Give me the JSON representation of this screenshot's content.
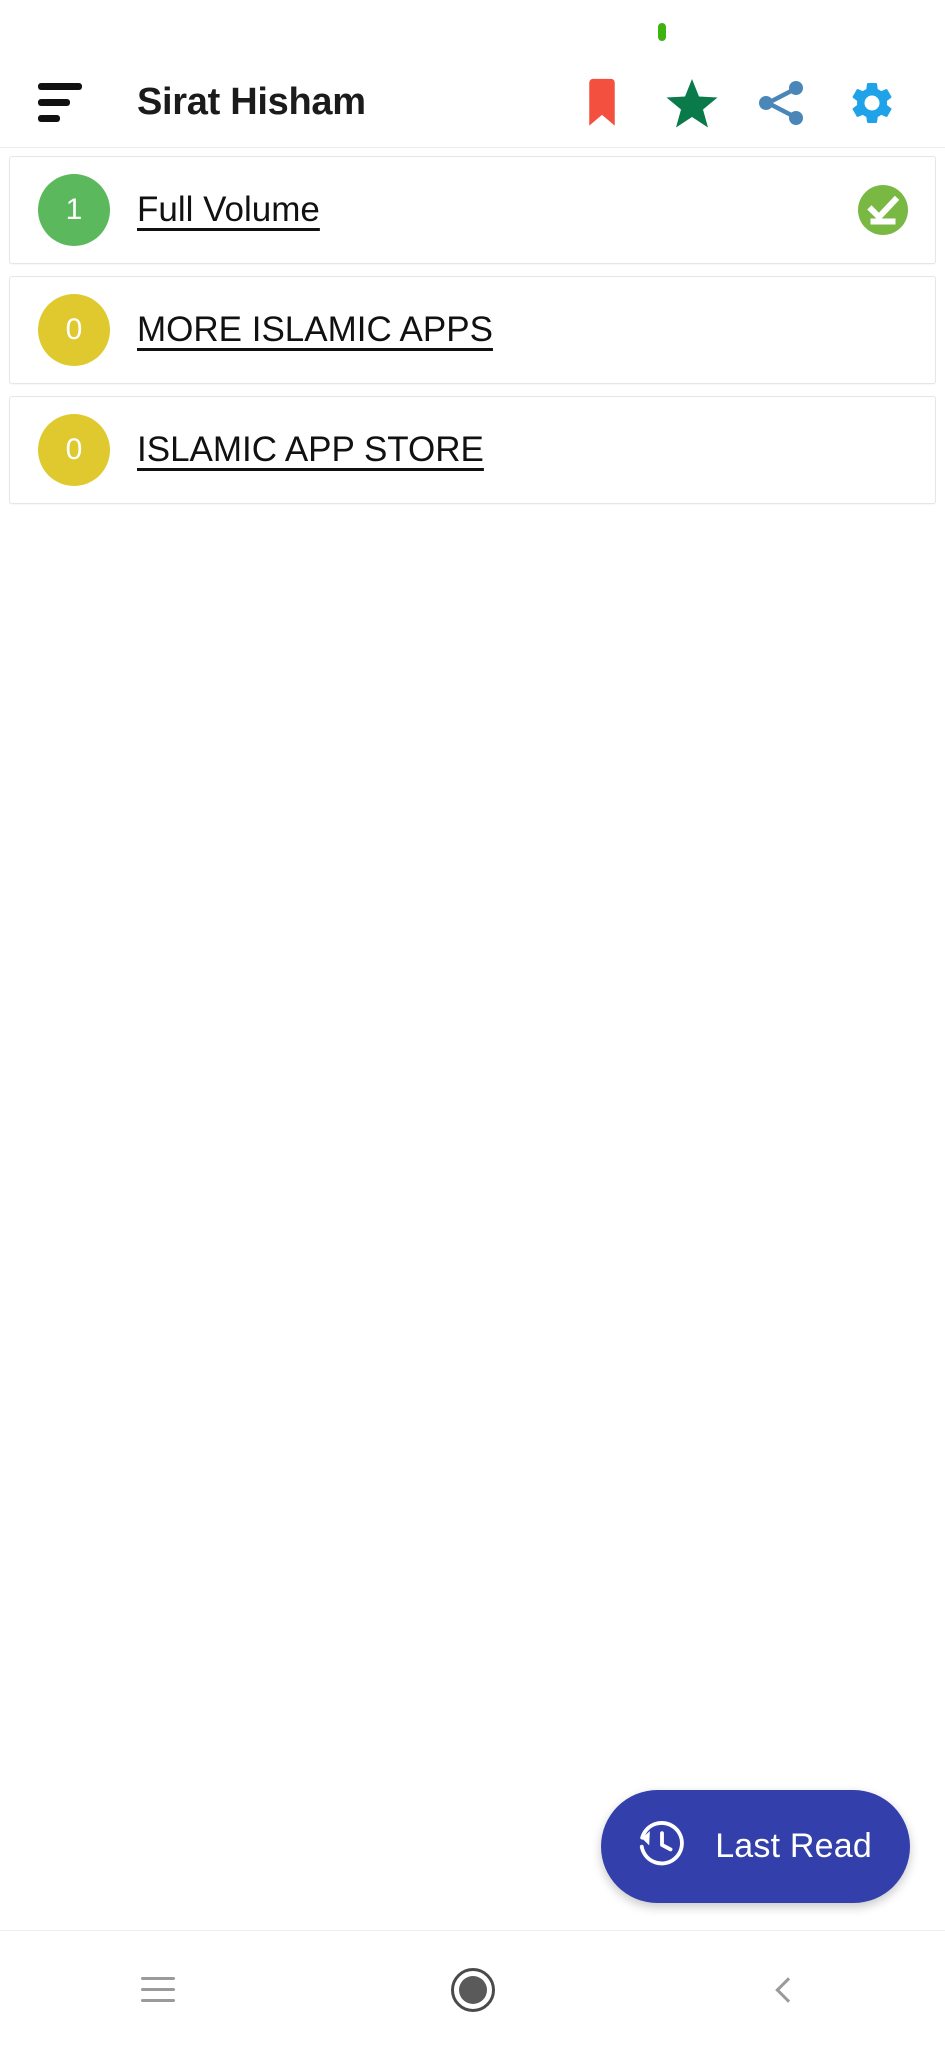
{
  "status_bar": {
    "indicator_name": "green-status-dot",
    "indicator_color": "#3eb211"
  },
  "app_bar": {
    "title": "Sirat Hisham",
    "menu_icon": "sort-menu-icon",
    "actions": [
      {
        "name": "bookmark-icon",
        "label": "Bookmark",
        "color": "#f4503f"
      },
      {
        "name": "star-icon",
        "label": "Favorite",
        "color": "#0b7a4b"
      },
      {
        "name": "share-icon",
        "label": "Share",
        "color": "#4a87b8"
      },
      {
        "name": "settings-gear-icon",
        "label": "Settings",
        "color": "#1fa2e8"
      }
    ]
  },
  "chapters": [
    {
      "count": "1",
      "label": "Full Volume",
      "badge_color": "#5cb85c",
      "status_icon": "completed-check-icon",
      "status_color": "#7ab844",
      "has_status": true
    },
    {
      "count": "0",
      "label": "MORE ISLAMIC APPS",
      "badge_color": "#e0c92e",
      "status_icon": "",
      "status_color": "",
      "has_status": false
    },
    {
      "count": "0",
      "label": "ISLAMIC APP STORE",
      "badge_color": "#e0c92e",
      "status_icon": "",
      "status_color": "",
      "has_status": false
    }
  ],
  "fab": {
    "label": "Last Read",
    "icon": "history-restore-icon",
    "color": "#3340ab"
  },
  "nav_bar": {
    "recents_icon": "recents-icon",
    "home_icon": "home-circle-icon",
    "back_icon": "back-chevron-icon"
  }
}
